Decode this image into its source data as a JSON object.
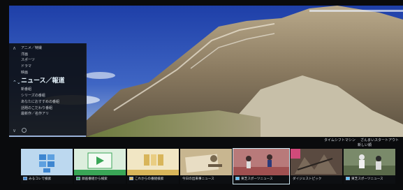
{
  "menu": {
    "items": [
      {
        "label": "アニメ／特撮"
      },
      {
        "label": "洋画"
      },
      {
        "label": "スポーツ"
      },
      {
        "label": "ドラマ"
      },
      {
        "label": "映画"
      },
      {
        "label": "ニュース／報道",
        "selected": true
      },
      {
        "label": "新番組"
      },
      {
        "label": "シリーズの番組"
      },
      {
        "label": "あなたにおすすめの番組"
      },
      {
        "label": "話題のこだわり番組"
      },
      {
        "label": "最新作／名作アリ"
      }
    ],
    "up_arrow": "∧",
    "down_arrow": "∨",
    "select_arrows": "⌃⌄"
  },
  "strip": {
    "top_titles": [
      "タイムシフトマシン",
      "ざんまいスタートアウト"
    ],
    "top_subtitles": [
      "新しい順"
    ],
    "tiles": [
      {
        "caption": "みるコレで検索",
        "icon": "grid-icon",
        "kind": "search"
      },
      {
        "caption": "録画番組から検索",
        "icon": "play-icon",
        "kind": "search"
      },
      {
        "caption": "これからの番組検索",
        "icon": "list-icon",
        "kind": "search"
      },
      {
        "caption": "今日の出来事ニュース",
        "icon": "news-icon",
        "kind": "program"
      },
      {
        "caption": "東芝スポーツニュース",
        "icon": "sports-icon",
        "kind": "program",
        "focused": true
      },
      {
        "caption": "ダイジェストピック",
        "icon": "news-icon",
        "kind": "program"
      },
      {
        "caption": "東芝スポーツニュース",
        "icon": "sports-icon",
        "kind": "program"
      }
    ]
  },
  "colors": {
    "accent": "#5ac8ff",
    "search_tile_top": "#bcd8ef",
    "search_tile_green": "#3aa657",
    "search_tile_yellow": "#d8b55a"
  }
}
